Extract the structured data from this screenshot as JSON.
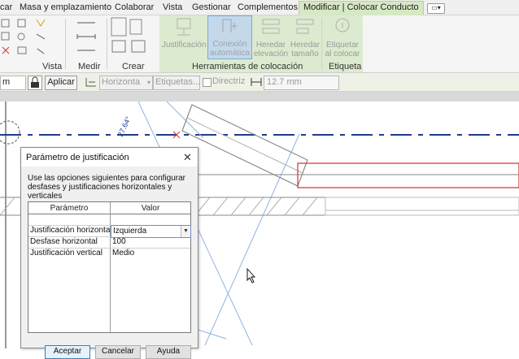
{
  "ribbon_tabs": {
    "t0": "car",
    "t1": "Masa y emplazamiento",
    "t2": "Colaborar",
    "t3": "Vista",
    "t4": "Gestionar",
    "t5": "Complementos",
    "active": "Modificar | Colocar Conducto"
  },
  "ribbon": {
    "group_vista": "Vista",
    "group_medir": "Medir",
    "group_crear": "Crear",
    "group_colocacion": "Herramientas de colocación",
    "group_etiqueta": "Etiqueta",
    "btn_justificacion": "Justificación",
    "btn_conexion_1": "Conexión",
    "btn_conexion_2": "automática",
    "btn_heredar_elev_1": "Heredar",
    "btn_heredar_elev_2": "elevación",
    "btn_heredar_tam_1": "Heredar",
    "btn_heredar_tam_2": "tamaño",
    "btn_etiquetar_1": "Etiquetar",
    "btn_etiquetar_2": "al colocar"
  },
  "options_bar": {
    "level_suffix": "m",
    "apply_label": "Aplicar",
    "orientation_value": "Horizonta",
    "tags_placeholder": "Etiquetas...",
    "directriz_label": "Directriz",
    "length_value": "12.7 mm"
  },
  "canvas": {
    "angle_label": "27.64°"
  },
  "dialog": {
    "title": "Parámetro de justificación",
    "close_glyph": "✕",
    "description": "Use las opciones siguientes para configurar desfases y justificaciones horizontales y verticales",
    "col_param": "Parámetro",
    "col_value": "Valor",
    "rows": [
      {
        "param": "Justificación horizontal",
        "value": "Izquierda"
      },
      {
        "param": "Desfase horizontal",
        "value": "100"
      },
      {
        "param": "Justificación vertical",
        "value": "Medio"
      }
    ],
    "btn_ok": "Aceptar",
    "btn_cancel": "Cancelar",
    "btn_help": "Ayuda"
  },
  "colors": {
    "ribbon_context": "#dcebcf",
    "duct_centerline": "#1f3c8c",
    "duct_red": "#e03a3a",
    "guide_blue": "#8fb3e6"
  }
}
